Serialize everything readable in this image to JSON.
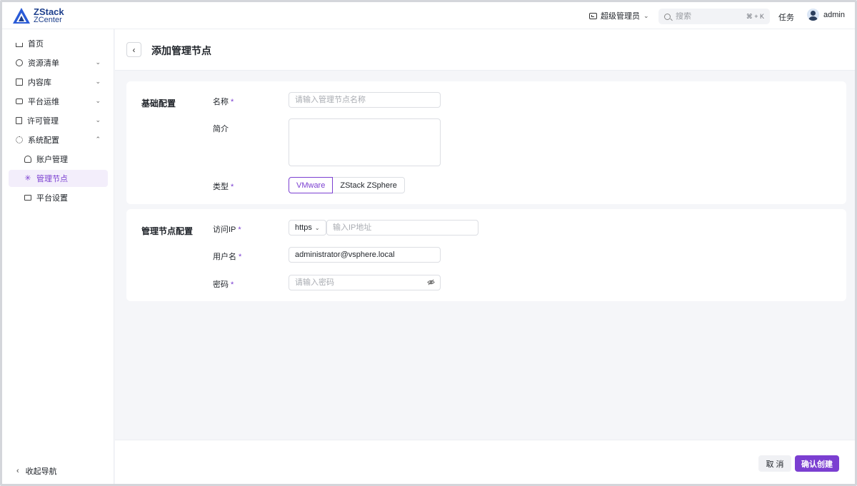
{
  "brand": {
    "line1": "ZStack",
    "line2": "ZCenter"
  },
  "header": {
    "role_label": "超级管理员",
    "search_placeholder": "搜索",
    "search_shortcut": "⌘ + K",
    "tasks_label": "任务",
    "user_name": "admin"
  },
  "sidebar": {
    "items": [
      {
        "label": "首页"
      },
      {
        "label": "资源清单"
      },
      {
        "label": "内容库"
      },
      {
        "label": "平台运维"
      },
      {
        "label": "许可管理"
      },
      {
        "label": "系统配置"
      },
      {
        "label": "账户管理"
      },
      {
        "label": "管理节点"
      },
      {
        "label": "平台设置"
      }
    ],
    "collapse_label": "收起导航"
  },
  "page": {
    "title": "添加管理节点"
  },
  "basic": {
    "section_title": "基础配置",
    "name_label": "名称",
    "name_placeholder": "请输入管理节点名称",
    "desc_label": "简介",
    "type_label": "类型",
    "type_options": [
      "VMware",
      "ZStack ZSphere"
    ],
    "required_mark": "*"
  },
  "node": {
    "section_title": "管理节点配置",
    "ip_label": "访问IP",
    "protocol": "https",
    "ip_placeholder": "输入IP地址",
    "username_label": "用户名",
    "username_value": "administrator@vsphere.local",
    "password_label": "密码",
    "password_placeholder": "请输入密码"
  },
  "footer": {
    "cancel_label": "取 消",
    "confirm_label": "确认创建"
  },
  "colors": {
    "accent": "#7b3fd1",
    "brand": "#1d3f8c"
  }
}
